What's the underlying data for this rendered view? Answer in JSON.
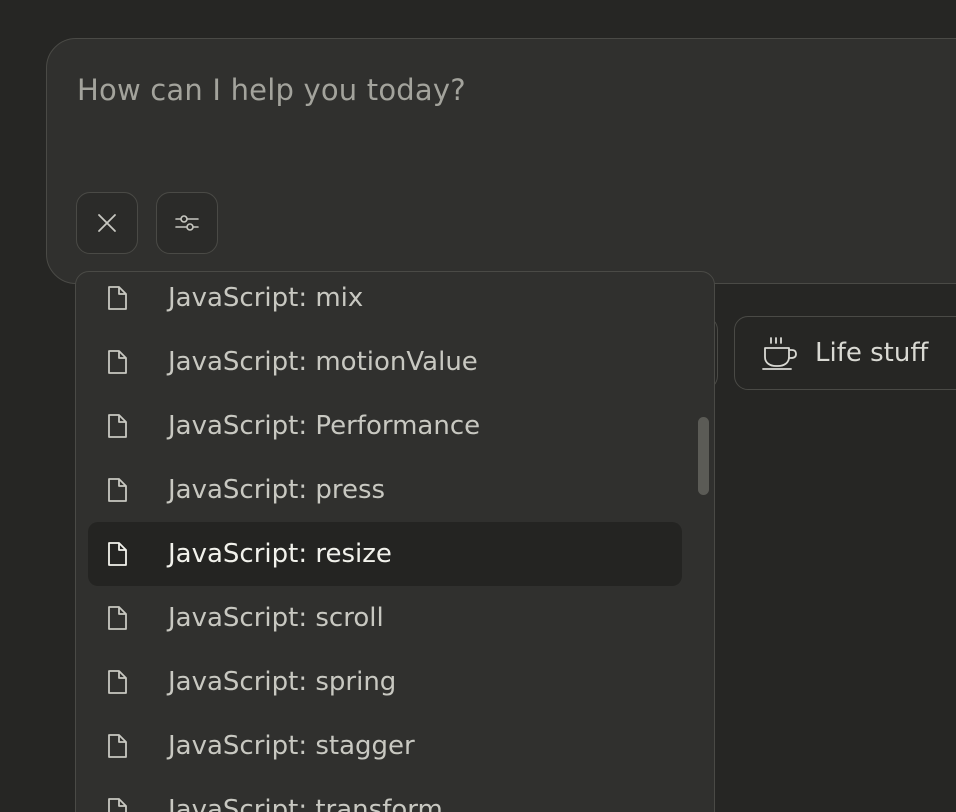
{
  "composer": {
    "placeholder": "How can I help you today?",
    "close_icon": "close-icon",
    "tools_icon": "sliders-icon"
  },
  "chips": [
    {
      "label": "Life stuff",
      "icon": "coffee-cup-icon"
    }
  ],
  "dropdown": {
    "items": [
      {
        "label": "JavaScript: mix",
        "icon": "document-icon"
      },
      {
        "label": "JavaScript: motionValue",
        "icon": "document-icon"
      },
      {
        "label": "JavaScript: Performance",
        "icon": "document-icon"
      },
      {
        "label": "JavaScript: press",
        "icon": "document-icon"
      },
      {
        "label": "JavaScript: resize",
        "icon": "document-icon",
        "highlighted": true
      },
      {
        "label": "JavaScript: scroll",
        "icon": "document-icon"
      },
      {
        "label": "JavaScript: spring",
        "icon": "document-icon"
      },
      {
        "label": "JavaScript: stagger",
        "icon": "document-icon"
      },
      {
        "label": "JavaScript: transform",
        "icon": "document-icon"
      }
    ]
  },
  "colors": {
    "background": "#262624",
    "surface": "#30302e",
    "border": "#4a4a46",
    "highlight": "#242422",
    "text": "#c8c8c1"
  }
}
